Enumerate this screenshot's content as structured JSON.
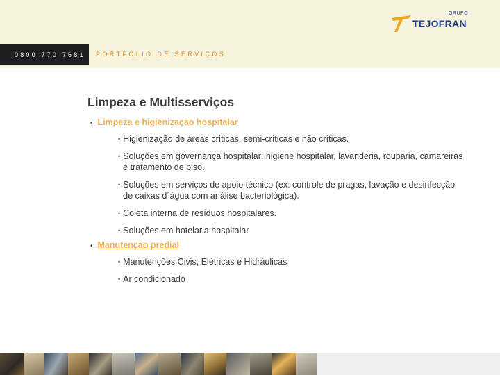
{
  "header": {
    "phone": "0800 770 7681",
    "section_title": "PORTFÓLIO DE SERVIÇOS",
    "logo": {
      "group_label": "GRUPO",
      "brand_name": "TEJOFRAN",
      "accent": "#f0a81e",
      "brand_color": "#1f3f86"
    }
  },
  "content": {
    "page_title": "Limpeza e Multisserviços",
    "sections": [
      {
        "title": "Limpeza e higienização hospitalar",
        "items": [
          "Higienização de áreas críticas, semi-críticas e não críticas.",
          "Soluções em governança hospitalar: higiene hospitalar, lavanderia, rouparia, camareiras e tratamento de piso.",
          "Soluções em serviços de apoio técnico (ex: controle de pragas, lavação e desinfecção de caixas d´água com análise bacteriológica).",
          "Coleta interna de resíduos hospitalares.",
          "Soluções em hotelaria hospitalar"
        ]
      },
      {
        "title": "Manutenção predial",
        "items": [
          "Manutenções Civis, Elétricas e Hidráulicas",
          "Ar condicionado"
        ]
      }
    ]
  },
  "colors": {
    "band": "#f6f3dc",
    "phone_bar": "#1f1f1f",
    "accent_orange": "#e08a1e",
    "link": "#f0b257",
    "text": "#3a3a3a"
  }
}
